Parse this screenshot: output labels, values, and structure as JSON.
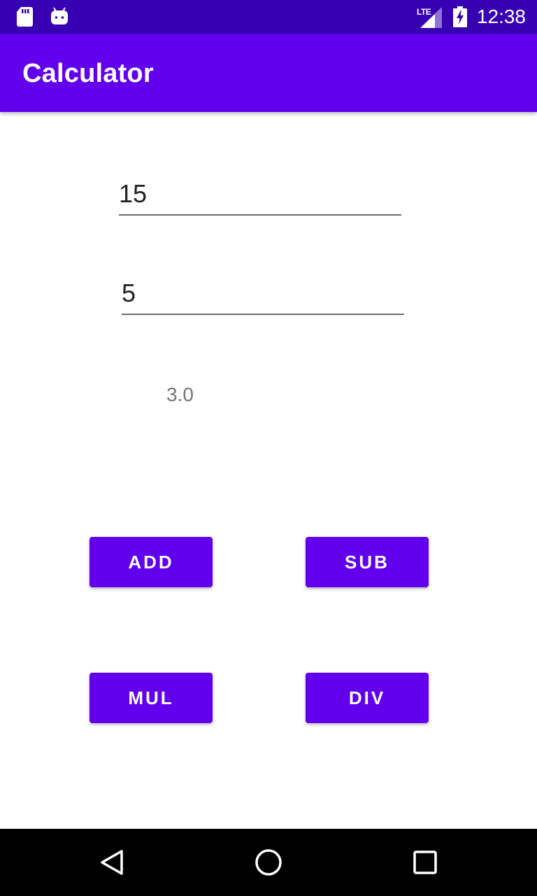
{
  "status_bar": {
    "time": "12:38",
    "network": "LTE",
    "icons": [
      "sd-card-icon",
      "android-icon",
      "signal-icon",
      "battery-charging-icon"
    ]
  },
  "app_bar": {
    "title": "Calculator"
  },
  "inputs": {
    "first_number": "15",
    "second_number": "5"
  },
  "result": {
    "value": "3.0"
  },
  "buttons": {
    "add": "ADD",
    "sub": "SUB",
    "mul": "MUL",
    "div": "DIV"
  },
  "navigation": {
    "icons": [
      "back-icon",
      "home-icon",
      "recents-icon"
    ]
  },
  "colors": {
    "primary": "#6200ee",
    "primary_dark": "#3700b3",
    "on_primary": "#ffffff"
  }
}
